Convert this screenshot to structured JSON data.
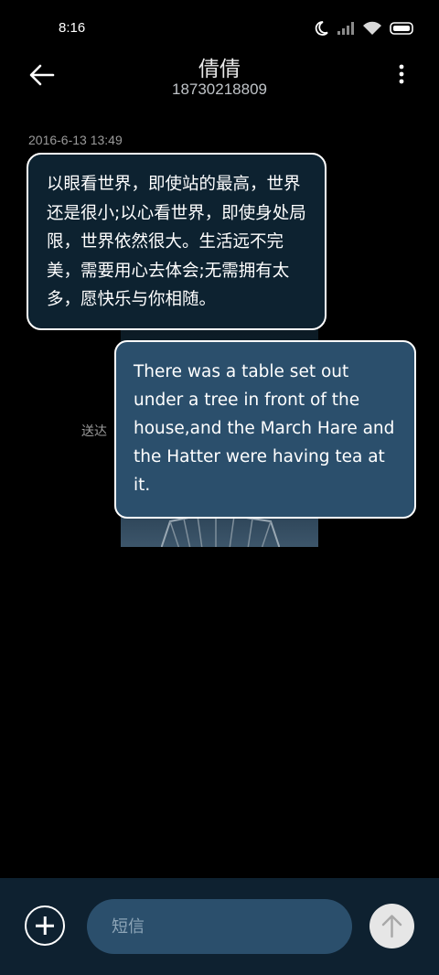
{
  "status_bar": {
    "time": "8:16",
    "icons": [
      "moon-icon",
      "signal-icon",
      "wifi-icon",
      "battery-icon"
    ]
  },
  "header": {
    "contact_name": "倩倩",
    "contact_number": "18730218809",
    "back_icon": "back-arrow-icon",
    "menu_icon": "more-vertical-icon"
  },
  "conversation": {
    "timestamp": "2016-6-13 13:49",
    "messages": [
      {
        "direction": "incoming",
        "text": "以眼看世界，即使站的最高，世界还是很小;以心看世界，即使身处局限，世界依然很大。生活远不完美，需要用心去体会;无需拥有太多，愿快乐与你相随。"
      },
      {
        "direction": "outgoing",
        "text": "There was a table set out under a tree in front of the house,and the March Hare and the Hatter were having tea at it.",
        "status": "送达"
      }
    ]
  },
  "composer": {
    "placeholder": "短信",
    "add_icon": "plus-circle-icon",
    "send_icon": "send-arrow-up-icon"
  },
  "colors": {
    "background": "#000000",
    "incoming_bubble": "#0d2230",
    "outgoing_bubble": "#2b4f6c",
    "composer_bar": "#0e2130",
    "input_field": "#2b4f6c",
    "send_button": "#e6e6e6"
  }
}
